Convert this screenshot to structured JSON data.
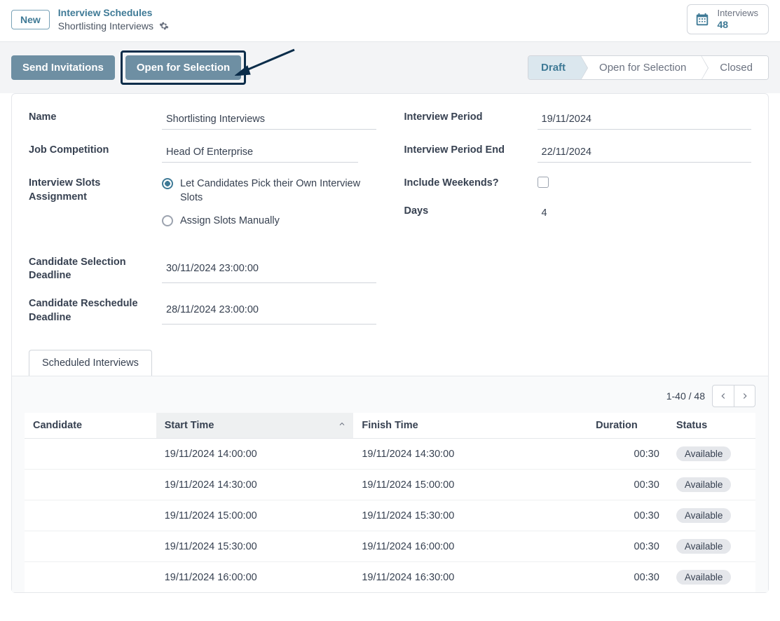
{
  "header": {
    "new_btn": "New",
    "breadcrumb_link": "Interview Schedules",
    "breadcrumb_sub": "Shortlisting Interviews",
    "stat_label": "Interviews",
    "stat_value": "48"
  },
  "actions": {
    "send_invitations": "Send Invitations",
    "open_for_selection": "Open for Selection",
    "stages": [
      "Draft",
      "Open for Selection",
      "Closed"
    ],
    "active_stage": 0
  },
  "form": {
    "labels": {
      "name": "Name",
      "job_competition": "Job Competition",
      "slots_assignment": "Interview Slots Assignment",
      "selection_deadline": "Candidate Selection Deadline",
      "reschedule_deadline": "Candidate Reschedule Deadline",
      "interview_period": "Interview Period",
      "interview_period_end": "Interview Period End",
      "include_weekends": "Include Weekends?",
      "days": "Days"
    },
    "values": {
      "name": "Shortlisting Interviews",
      "job_competition": "Head Of Enterprise",
      "slot_options": [
        "Let Candidates Pick their Own Interview Slots",
        "Assign Slots Manually"
      ],
      "slot_selected": 0,
      "selection_deadline": "30/11/2024 23:00:00",
      "reschedule_deadline": "28/11/2024 23:00:00",
      "interview_period": "19/11/2024",
      "interview_period_end": "22/11/2024",
      "include_weekends": false,
      "days": "4"
    }
  },
  "tabs": {
    "scheduled": "Scheduled Interviews"
  },
  "table": {
    "pager_info": "1-40 / 48",
    "headers": {
      "candidate": "Candidate",
      "start": "Start Time",
      "finish": "Finish Time",
      "duration": "Duration",
      "status": "Status"
    },
    "rows": [
      {
        "candidate": "",
        "start": "19/11/2024 14:00:00",
        "finish": "19/11/2024 14:30:00",
        "duration": "00:30",
        "status": "Available"
      },
      {
        "candidate": "",
        "start": "19/11/2024 14:30:00",
        "finish": "19/11/2024 15:00:00",
        "duration": "00:30",
        "status": "Available"
      },
      {
        "candidate": "",
        "start": "19/11/2024 15:00:00",
        "finish": "19/11/2024 15:30:00",
        "duration": "00:30",
        "status": "Available"
      },
      {
        "candidate": "",
        "start": "19/11/2024 15:30:00",
        "finish": "19/11/2024 16:00:00",
        "duration": "00:30",
        "status": "Available"
      },
      {
        "candidate": "",
        "start": "19/11/2024 16:00:00",
        "finish": "19/11/2024 16:30:00",
        "duration": "00:30",
        "status": "Available"
      }
    ]
  }
}
